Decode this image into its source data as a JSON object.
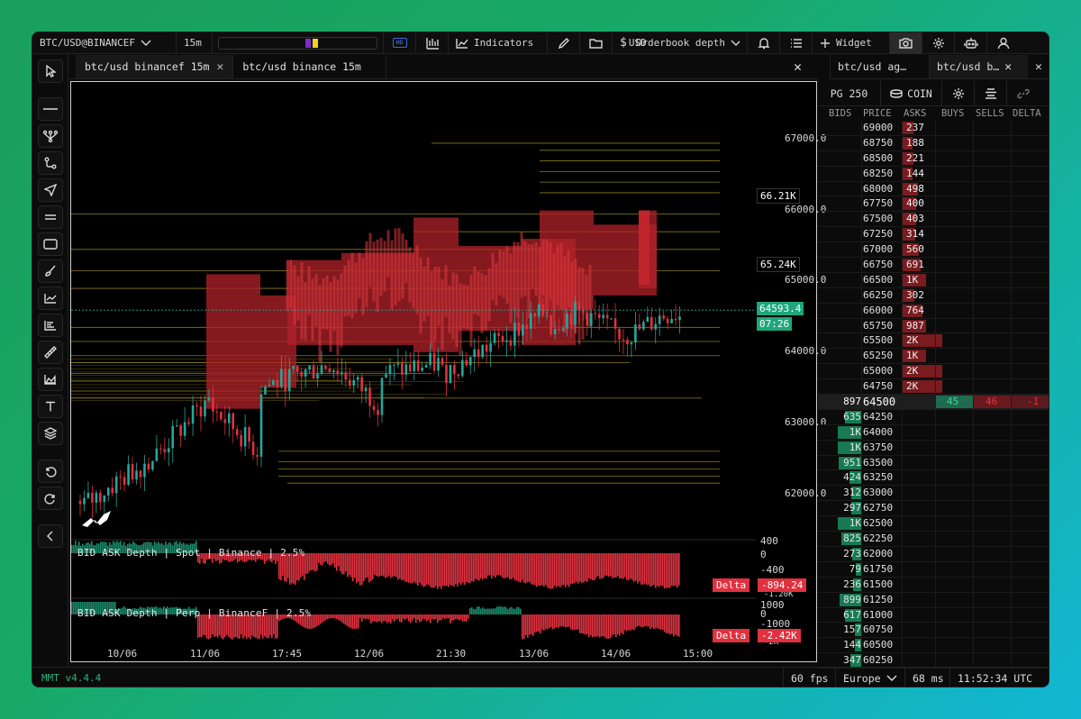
{
  "toolbar": {
    "symbol": "BTC/USD@BINANCEF",
    "timeframe": "15m",
    "hd_badge": "HD",
    "indicators_label": "Indicators",
    "widget_overlay_text": "Orderbook depth",
    "widget_overlay_prefix": "USD",
    "add_widget_label": "Widget"
  },
  "tabs": [
    {
      "label": "btc/usd binancef 15m",
      "active": true
    },
    {
      "label": "btc/usd binance 15m",
      "active": false
    }
  ],
  "chart": {
    "price_axis": [
      "67000.0",
      "66000.0",
      "65000.0",
      "64000.0",
      "63000.0",
      "62000.0"
    ],
    "level_tags": [
      "66.21K",
      "65.24K"
    ],
    "last_price": "64593.4",
    "countdown": "07:26",
    "x_labels": [
      "10/06",
      "11/06",
      "17:45",
      "12/06",
      "21:30",
      "13/06",
      "14/06",
      "15:00"
    ],
    "indicator1": {
      "label": "BID ASK Depth | Spot | Binance | 2.5%",
      "axis": [
        "400",
        "0",
        "-400",
        "-1.20K"
      ],
      "delta_label": "Delta",
      "delta_value": "-894.24"
    },
    "indicator2": {
      "label": "BID ASK Depth | Perp | BinanceF | 2.5%",
      "axis": [
        "1000",
        "0",
        "-1000",
        "-2K"
      ],
      "delta_label": "Delta",
      "delta_value": "-2.42K"
    }
  },
  "orderbook": {
    "tabs": [
      "btc/usd ag…",
      "btc/usd b…"
    ],
    "grouping": "PG 250",
    "unit": "COIN",
    "headers": [
      "BIDS",
      "PRICE",
      "ASKS",
      "BUYS",
      "SELLS",
      "DELTA"
    ],
    "asks": [
      {
        "price": "69000",
        "size": "237"
      },
      {
        "price": "68750",
        "size": "188"
      },
      {
        "price": "68500",
        "size": "221"
      },
      {
        "price": "68250",
        "size": "144"
      },
      {
        "price": "68000",
        "size": "498"
      },
      {
        "price": "67750",
        "size": "400"
      },
      {
        "price": "67500",
        "size": "403"
      },
      {
        "price": "67250",
        "size": "314"
      },
      {
        "price": "67000",
        "size": "560"
      },
      {
        "price": "66750",
        "size": "691"
      },
      {
        "price": "66500",
        "size": "1K"
      },
      {
        "price": "66250",
        "size": "302"
      },
      {
        "price": "66000",
        "size": "764"
      },
      {
        "price": "65750",
        "size": "987"
      },
      {
        "price": "65500",
        "size": "2K"
      },
      {
        "price": "65250",
        "size": "1K"
      },
      {
        "price": "65000",
        "size": "2K"
      },
      {
        "price": "64750",
        "size": "2K"
      }
    ],
    "mid": {
      "bid": "897",
      "price": "64500",
      "buys": "45",
      "sells": "46",
      "delta": "-1"
    },
    "bids": [
      {
        "price": "64250",
        "size": "635"
      },
      {
        "price": "64000",
        "size": "1K"
      },
      {
        "price": "63750",
        "size": "1K"
      },
      {
        "price": "63500",
        "size": "951"
      },
      {
        "price": "63250",
        "size": "424"
      },
      {
        "price": "63000",
        "size": "312"
      },
      {
        "price": "62750",
        "size": "297"
      },
      {
        "price": "62500",
        "size": "1K"
      },
      {
        "price": "62250",
        "size": "825"
      },
      {
        "price": "62000",
        "size": "273"
      },
      {
        "price": "61750",
        "size": "79"
      },
      {
        "price": "61500",
        "size": "236"
      },
      {
        "price": "61250",
        "size": "899"
      },
      {
        "price": "61000",
        "size": "617"
      },
      {
        "price": "60750",
        "size": "157"
      },
      {
        "price": "60500",
        "size": "144"
      },
      {
        "price": "60250",
        "size": "347"
      }
    ]
  },
  "status": {
    "version": "MMT v4.4.4",
    "fps": "60 fps",
    "region": "Europe",
    "latency": "68 ms",
    "clock": "11:52:34 UTC"
  },
  "colors": {
    "bull": "#26a69a",
    "bear": "#e0313f",
    "bid_bar": "#177a55",
    "ask_bar": "#7a1b1f",
    "level_line": "#b9a31e"
  }
}
